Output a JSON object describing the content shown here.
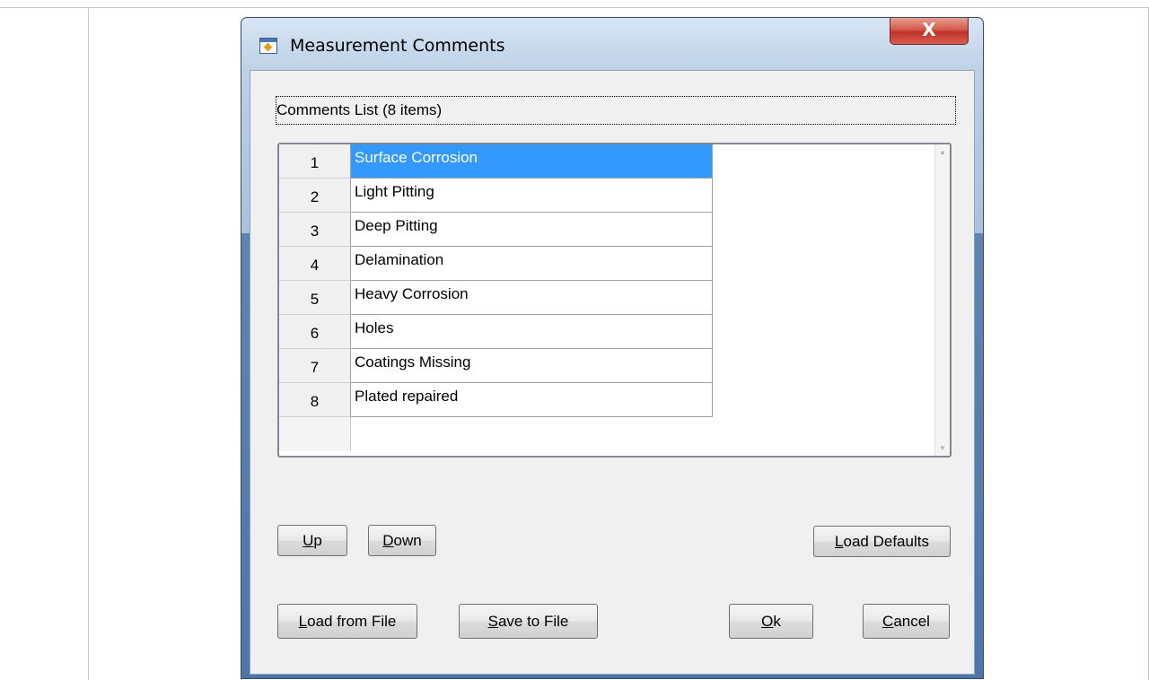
{
  "window": {
    "title": "Measurement Comments",
    "close_glyph": "X"
  },
  "comments": {
    "label": "Comments List (8 items)",
    "rows": [
      {
        "num": "1",
        "text": "Surface Corrosion"
      },
      {
        "num": "2",
        "text": "Light Pitting"
      },
      {
        "num": "3",
        "text": "Deep Pitting"
      },
      {
        "num": "4",
        "text": "Delamination"
      },
      {
        "num": "5",
        "text": "Heavy Corrosion"
      },
      {
        "num": "6",
        "text": "Holes"
      },
      {
        "num": "7",
        "text": "Coatings Missing"
      },
      {
        "num": "8",
        "text": "Plated repaired"
      }
    ],
    "selected_row": "1"
  },
  "buttons": {
    "up": {
      "mnemonic": "U",
      "rest": "p"
    },
    "down": {
      "mnemonic": "D",
      "rest": "own"
    },
    "load_defaults": {
      "mnemonic": "L",
      "rest": "oad Defaults"
    },
    "load_from_file": {
      "mnemonic": "L",
      "rest": "oad from File"
    },
    "save_to_file": {
      "mnemonic": "S",
      "rest": "ave to File"
    },
    "ok": {
      "mnemonic": "O",
      "rest": "k"
    },
    "cancel": {
      "mnemonic": "C",
      "rest": "ancel"
    }
  },
  "colors": {
    "selection": "#3399ff",
    "close_button": "#c0302a"
  },
  "icons": {
    "app": "app-window-icon",
    "close": "close-icon"
  }
}
